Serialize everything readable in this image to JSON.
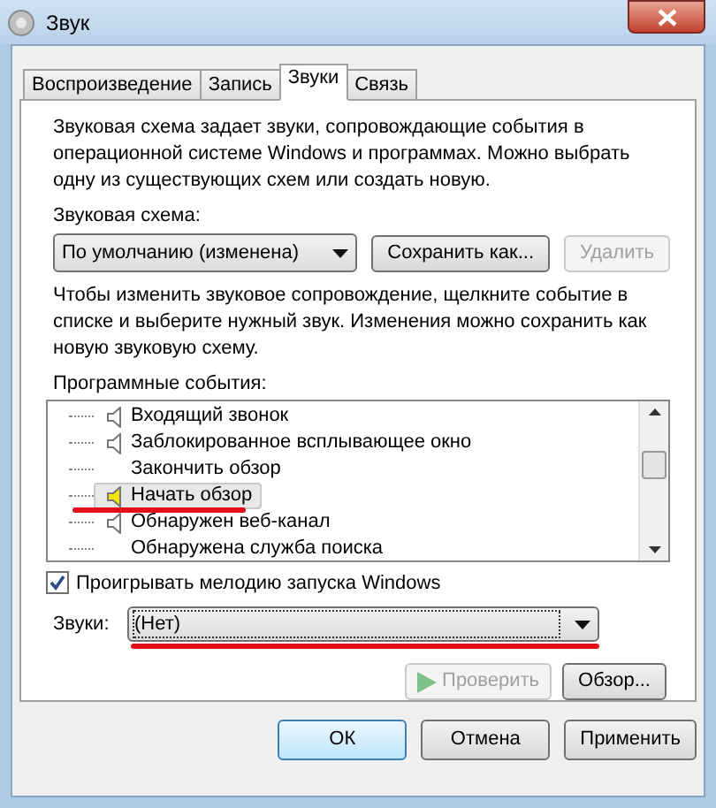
{
  "window": {
    "title": "Звук"
  },
  "tabs": [
    {
      "label": "Воспроизведение",
      "selected": false
    },
    {
      "label": "Запись",
      "selected": false
    },
    {
      "label": "Звуки",
      "selected": true
    },
    {
      "label": "Связь",
      "selected": false
    }
  ],
  "scheme": {
    "description": "Звуковая схема задает звуки, сопровождающие события в операционной системе Windows и программах. Можно выбрать одну из существующих схем или создать новую.",
    "label": "Звуковая схема:",
    "value": "По умолчанию (изменена)",
    "save_button": {
      "label": "Сохранить как...",
      "disabled": false
    },
    "delete_button": {
      "label": "Удалить",
      "disabled": true
    }
  },
  "events": {
    "hint": "Чтобы изменить звуковое сопровождение, щелкните событие в списке и выберите нужный звук. Изменения можно сохранить как новую звуковую схему.",
    "label": "Программные события:",
    "items": [
      {
        "label": "Входящий звонок",
        "has_sound": true,
        "selected": false,
        "annotated": false
      },
      {
        "label": "Заблокированное всплывающее окно",
        "has_sound": true,
        "selected": false,
        "annotated": false
      },
      {
        "label": "Закончить обзор",
        "has_sound": false,
        "selected": false,
        "annotated": false
      },
      {
        "label": "Начать обзор",
        "has_sound": true,
        "selected": true,
        "annotated": true
      },
      {
        "label": "Обнаружен веб-канал",
        "has_sound": true,
        "selected": false,
        "annotated": false
      },
      {
        "label": "Обнаружена служба поиска",
        "has_sound": false,
        "selected": false,
        "annotated": false
      }
    ]
  },
  "startup_checkbox": {
    "label": "Проигрывать мелодию запуска Windows",
    "checked": true
  },
  "sounds": {
    "label": "Звуки:",
    "value": "(Нет)",
    "annotated": true
  },
  "test_button": {
    "label": "Проверить",
    "disabled": true
  },
  "browse_button": {
    "label": "Обзор...",
    "disabled": false
  },
  "buttons": [
    {
      "label": "ОК",
      "default": true,
      "disabled": false
    },
    {
      "label": "Отмена",
      "default": false,
      "disabled": false
    },
    {
      "label": "Применить",
      "default": false,
      "disabled": false
    }
  ]
}
